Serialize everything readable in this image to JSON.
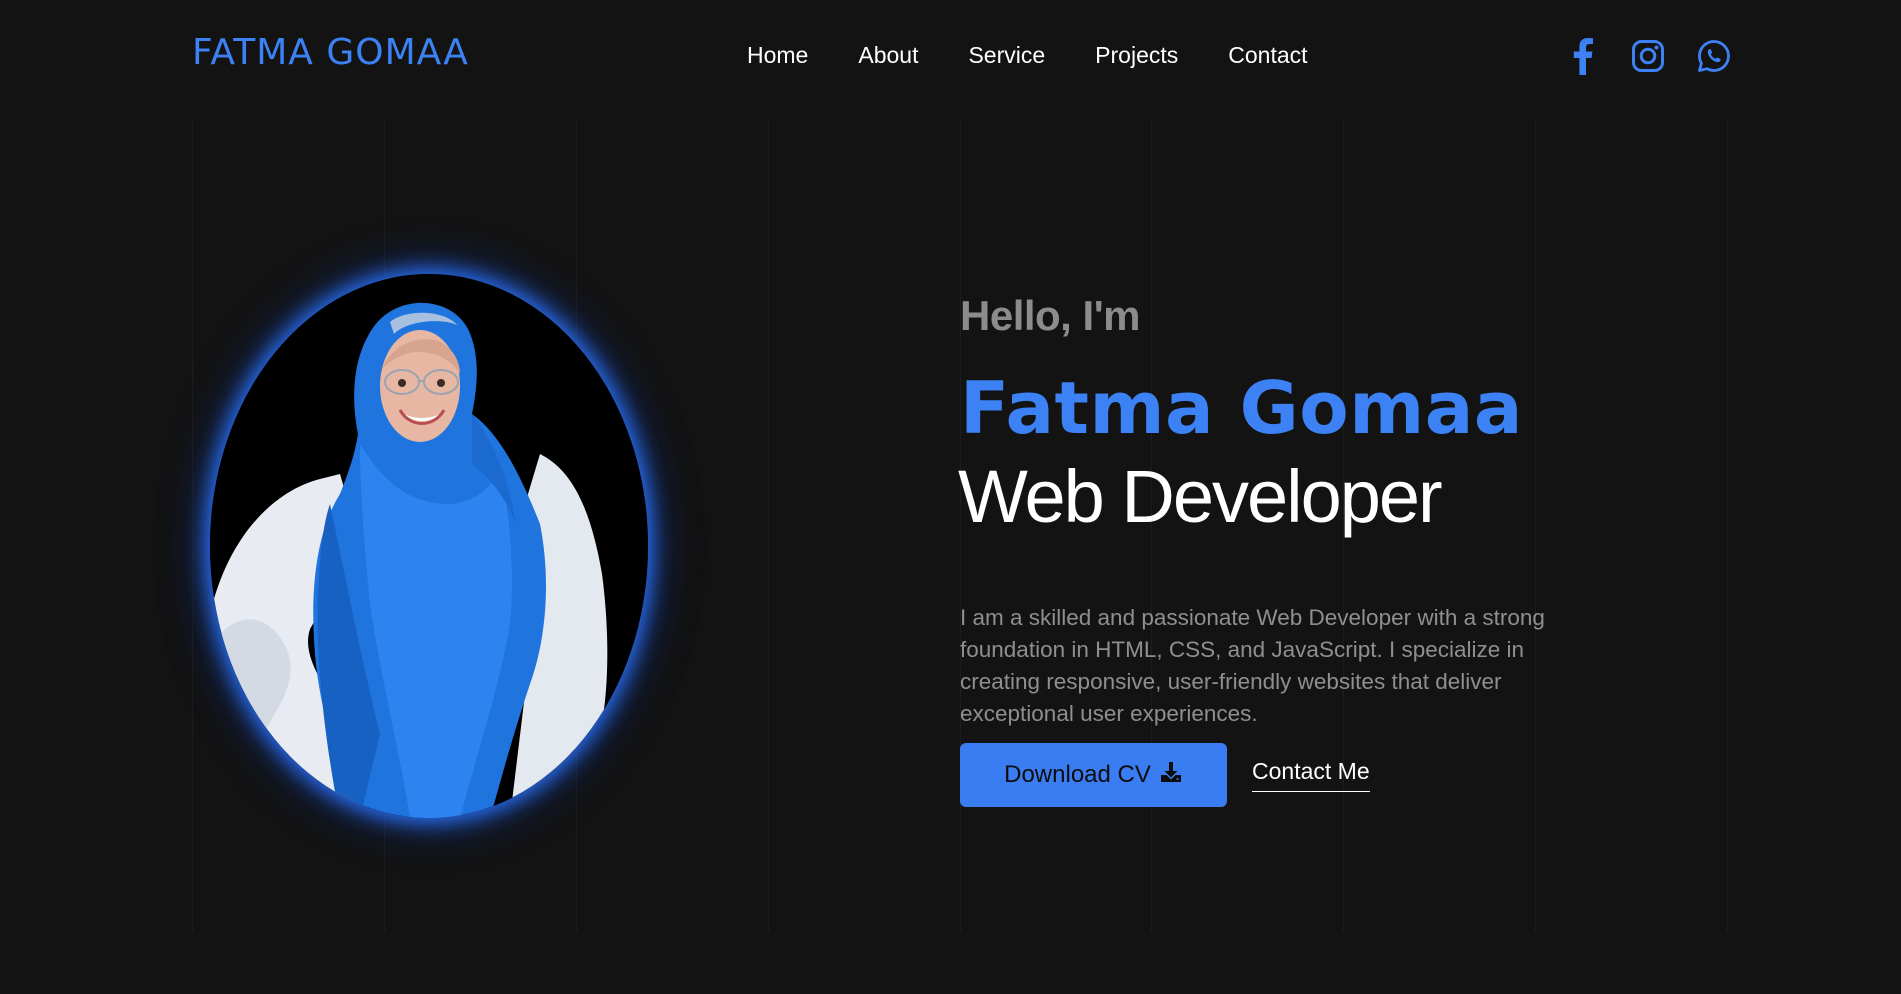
{
  "header": {
    "brand": "FATMA GOMAA",
    "nav": [
      {
        "label": "Home"
      },
      {
        "label": "About"
      },
      {
        "label": "Service"
      },
      {
        "label": "Projects"
      },
      {
        "label": "Contact"
      }
    ],
    "socials": [
      "facebook-icon",
      "instagram-icon",
      "whatsapp-icon"
    ]
  },
  "hero": {
    "greeting": "Hello, I'm",
    "name": "Fatma Gomaa",
    "role": "Web Developer",
    "bio": "I am a skilled and passionate Web Developer with a strong foundation in HTML, CSS, and JavaScript. I specialize in creating responsive, user-friendly websites that deliver exceptional user experiences.",
    "cv_button": "Download CV",
    "contact_link": "Contact Me"
  },
  "colors": {
    "accent": "#3d82f5",
    "background": "#131313",
    "muted_text": "#8c8c8c"
  }
}
